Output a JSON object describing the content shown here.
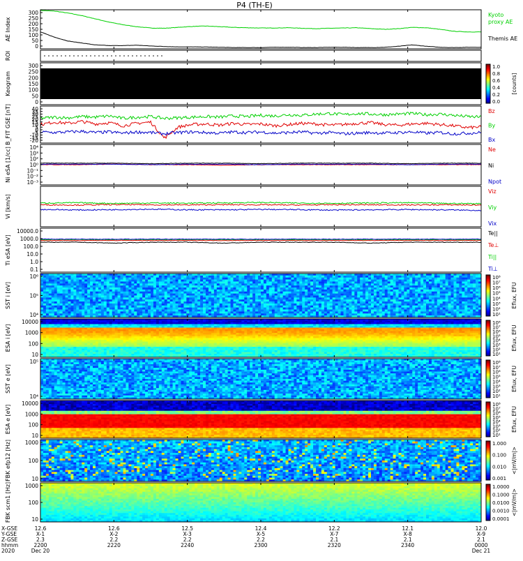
{
  "title": "P4 (TH-E)",
  "colors": {
    "frame": "#000000",
    "green": "#00d000",
    "red": "#e00000",
    "blue": "#0000c8",
    "black": "#000000"
  },
  "time_axis": {
    "range": [
      "2020-12-20 22:00",
      "2020-12-21 00:00"
    ],
    "row_labels": [
      "X-GSE",
      "Y-GSE",
      "Z-GSE",
      "hhmm",
      "2020"
    ],
    "tick_times": [
      "2200",
      "2220",
      "2240",
      "2300",
      "2320",
      "2340",
      "0000"
    ],
    "tick_positions_hint": "evenly spaced 20 min",
    "ticks": [
      {
        "x": "12.6",
        "y": "X-1",
        "z": "2.3",
        "hhmm": "2200",
        "date": "Dec 20"
      },
      {
        "x": "12.6",
        "y": "X-2",
        "z": "2.2",
        "hhmm": "2220",
        "date": ""
      },
      {
        "x": "12.5",
        "y": "X-3",
        "z": "2.2",
        "hhmm": "2240",
        "date": ""
      },
      {
        "x": "12.4",
        "y": "X-5",
        "z": "2.2",
        "hhmm": "2300",
        "date": ""
      },
      {
        "x": "12.2",
        "y": "X-7",
        "z": "2.1",
        "hhmm": "2320",
        "date": ""
      },
      {
        "x": "12.1",
        "y": "X-8",
        "z": "2.1",
        "hhmm": "2340",
        "date": ""
      },
      {
        "x": "12.0",
        "y": "X-9",
        "z": "2.1",
        "hhmm": "0000",
        "date": "Dec 21"
      }
    ]
  },
  "chart_data": [
    {
      "type": "line",
      "ylabel": "AE Index",
      "ylim": [
        0,
        300
      ],
      "yticks": [
        "300",
        "250",
        "200",
        "150",
        "100",
        "50",
        "0"
      ],
      "legend": [
        "Kyoto proxy AE",
        "Themis AE"
      ],
      "series": [
        {
          "name": "Kyoto proxy AE",
          "color": "#00d000",
          "values": [
            295,
            290,
            275,
            255,
            230,
            205,
            185,
            170,
            160,
            158,
            165,
            172,
            175,
            170,
            165,
            162,
            160,
            160,
            162,
            158,
            155,
            158,
            160,
            162,
            155,
            150,
            155,
            165,
            162,
            150,
            135,
            130,
            130
          ]
        },
        {
          "name": "Themis AE",
          "color": "#000000",
          "values": [
            130,
            90,
            60,
            45,
            30,
            25,
            25,
            28,
            22,
            18,
            15,
            15,
            14,
            12,
            10,
            10,
            10,
            12,
            12,
            10,
            10,
            12,
            12,
            10,
            10,
            12,
            20,
            30,
            20,
            12,
            10,
            12,
            12
          ]
        }
      ]
    },
    {
      "type": "scatter",
      "ylabel": "ROI",
      "note_dots_until_time": "2250"
    },
    {
      "type": "heatmap",
      "ylabel": "Keogram",
      "ylim": [
        0,
        300
      ],
      "yticks": [
        "300",
        "250",
        "200",
        "150",
        "100",
        "50",
        "0"
      ],
      "colorbar": {
        "label": "[counts]",
        "ticks": [
          "1.0",
          "0.8",
          "0.6",
          "0.4",
          "0.2",
          "0.0"
        ]
      }
    },
    {
      "type": "line",
      "ylabel": "B_FIT GSE [nT]",
      "ylim": [
        -20,
        40
      ],
      "yticks": [
        "40",
        "35",
        "30",
        "25",
        "20",
        "15",
        "10",
        "5",
        "0",
        "-5",
        "-10",
        "-15",
        "-20"
      ],
      "legend": [
        "Bz",
        "By",
        "Bx"
      ],
      "series": [
        {
          "name": "Bz",
          "color": "#e00000",
          "values": [
            10,
            14,
            12,
            15,
            11,
            13,
            8,
            12,
            14,
            -12,
            6,
            10,
            11,
            9,
            12,
            10,
            11,
            8,
            10,
            12,
            11,
            9,
            10,
            12,
            13,
            10,
            9,
            11,
            12,
            10,
            8,
            5,
            6
          ]
        },
        {
          "name": "By",
          "color": "#00d000",
          "values": [
            20,
            22,
            21,
            23,
            22,
            24,
            20,
            22,
            23,
            20,
            21,
            22,
            23,
            22,
            24,
            23,
            25,
            24,
            26,
            25,
            27,
            28,
            26,
            28,
            27,
            26,
            27,
            28,
            26,
            27,
            25,
            23,
            22
          ]
        },
        {
          "name": "Bx",
          "color": "#0000c8",
          "values": [
            -2,
            -3,
            -2,
            -1,
            -3,
            -2,
            -4,
            -2,
            -3,
            -5,
            -3,
            -2,
            -3,
            -4,
            -2,
            -3,
            -2,
            -4,
            -3,
            -2,
            -4,
            -3,
            -5,
            -4,
            -3,
            -4,
            -3,
            -2,
            -4,
            -3,
            -5,
            -4,
            -3
          ]
        }
      ]
    },
    {
      "type": "line",
      "ylabel": "Ni eSA [1/cc]",
      "ylim_log10": [
        -3,
        5
      ],
      "yticks": [
        "10⁴",
        "10³",
        "10²",
        "10⁰",
        "10⁻¹",
        "10⁻²",
        "10⁻³"
      ],
      "legend": [
        "Ne",
        "Ni",
        "Npot"
      ],
      "series": [
        {
          "name": "Ne",
          "color": "#e00000",
          "values_log10": [
            1.0,
            1.0,
            1.1,
            1.0,
            1.0,
            0.9,
            1.0,
            1.0,
            1.0,
            1.0,
            1.0,
            1.0,
            1.0
          ]
        },
        {
          "name": "Ni",
          "color": "#000000",
          "values_log10": [
            1.3,
            1.3,
            1.3,
            1.2,
            1.3,
            1.3,
            1.2,
            1.3,
            1.3,
            1.3,
            1.2,
            1.3,
            1.3
          ]
        },
        {
          "name": "Npot",
          "color": "#0000c8",
          "values_log10": [
            1.1,
            1.1,
            1.1,
            1.0,
            1.1,
            1.1,
            1.0,
            1.1,
            1.1,
            1.1,
            1.0,
            1.1,
            1.1
          ]
        }
      ]
    },
    {
      "type": "line",
      "ylabel": "Vi [km/s]",
      "legend": [
        "Viz",
        "Viy",
        "Vix"
      ],
      "series": [
        {
          "name": "Viz",
          "color": "#e00000",
          "values": [
            40,
            38,
            42,
            40,
            39,
            41,
            40,
            38,
            41,
            40,
            39,
            40,
            38
          ]
        },
        {
          "name": "Viy",
          "color": "#00d000",
          "values": [
            55,
            58,
            52,
            56,
            54,
            57,
            60,
            55,
            53,
            56,
            58,
            52,
            50
          ]
        },
        {
          "name": "Vix",
          "color": "#0000c8",
          "values": [
            0,
            -5,
            -2,
            2,
            -3,
            -4,
            0,
            -2,
            -6,
            -3,
            -1,
            -4,
            -8
          ]
        }
      ]
    },
    {
      "type": "line",
      "ylabel": "Ti eSA [eV]",
      "ylim_log10": [
        -1,
        4
      ],
      "yticks": [
        "10000.0",
        "1000.0",
        "100.0",
        "10.0",
        "1.0",
        "0.1"
      ],
      "legend": [
        "Te||",
        "Te⊥",
        "Ti||",
        "Ti⊥"
      ],
      "series": [
        {
          "name": "Te||",
          "color": "#000000",
          "values_log10": [
            2.4,
            2.4,
            2.3,
            2.4,
            2.4,
            2.3,
            2.4,
            2.4,
            2.4,
            2.3,
            2.4,
            2.4,
            2.4
          ]
        },
        {
          "name": "Te⊥",
          "color": "#e00000",
          "values_log10": [
            2.6,
            2.6,
            2.6,
            2.6,
            2.6,
            2.6,
            2.6,
            2.6,
            2.6,
            2.6,
            2.6,
            2.6,
            2.6
          ]
        },
        {
          "name": "Ti||",
          "color": "#00d000",
          "values_log10": [
            2.7,
            2.7,
            2.7,
            2.7,
            2.7,
            2.7,
            2.7,
            2.7,
            2.7,
            2.7,
            2.7,
            2.7,
            2.7
          ]
        },
        {
          "name": "Ti⊥",
          "color": "#0000c8",
          "values_log10": [
            2.75,
            2.75,
            2.75,
            2.75,
            2.75,
            2.75,
            2.75,
            2.75,
            2.75,
            2.75,
            2.75,
            2.75,
            2.75
          ]
        }
      ]
    },
    {
      "type": "heatmap",
      "ylabel": "SST i [eV]",
      "yticks": [
        "10⁶",
        "10⁵",
        "10⁴"
      ],
      "colorbar": {
        "label": "Eflux, EFU",
        "ticks": [
          "10⁸",
          "10⁷",
          "10⁶",
          "10⁵",
          "10⁴",
          "10³",
          "10²",
          "10¹"
        ]
      },
      "pattern": "speckle_blue"
    },
    {
      "type": "heatmap",
      "ylabel": "ESA i [eV]",
      "yticks": [
        "10000",
        "1000",
        "100",
        "10"
      ],
      "colorbar": {
        "label": "Eflux, EFU",
        "ticks": [
          "10⁸",
          "10⁷",
          "10⁶",
          "10⁵",
          "10⁴",
          "10³",
          "10²",
          "10¹"
        ]
      },
      "pattern": "ion_esa"
    },
    {
      "type": "heatmap",
      "ylabel": "SST e [eV]",
      "yticks": [
        "10⁵",
        "10⁴"
      ],
      "colorbar": {
        "label": "Eflux, EFU",
        "ticks": [
          "10⁸",
          "10⁷",
          "10⁶",
          "10⁵",
          "10⁴",
          "10³",
          "10²",
          "10¹"
        ]
      },
      "pattern": "speckle_blue"
    },
    {
      "type": "heatmap",
      "ylabel": "ESA e [eV]",
      "yticks": [
        "10000",
        "1000",
        "100",
        "10"
      ],
      "colorbar": {
        "label": "Eflux, EFU",
        "ticks": [
          "10⁸",
          "10⁷",
          "10⁶",
          "10⁵",
          "10⁴",
          "10³",
          "10²",
          "10¹"
        ]
      },
      "pattern": "electron_esa"
    },
    {
      "type": "heatmap",
      "ylabel": "FBK efp12 [Hz]",
      "yticks": [
        "1000",
        "100",
        "10"
      ],
      "colorbar": {
        "label": "<|mV/m|>",
        "ticks": [
          "1.000",
          "0.100",
          "0.010",
          "0.001"
        ]
      },
      "pattern": "fbk_e"
    },
    {
      "type": "heatmap",
      "ylabel": "FBK scm1 [Hz]",
      "yticks": [
        "1000",
        "100",
        "10"
      ],
      "colorbar": {
        "label": "<|mV/m|>",
        "ticks": [
          "1.0000",
          "0.1000",
          "0.0100",
          "0.0010",
          "0.0001"
        ]
      },
      "pattern": "fbk_b"
    }
  ]
}
